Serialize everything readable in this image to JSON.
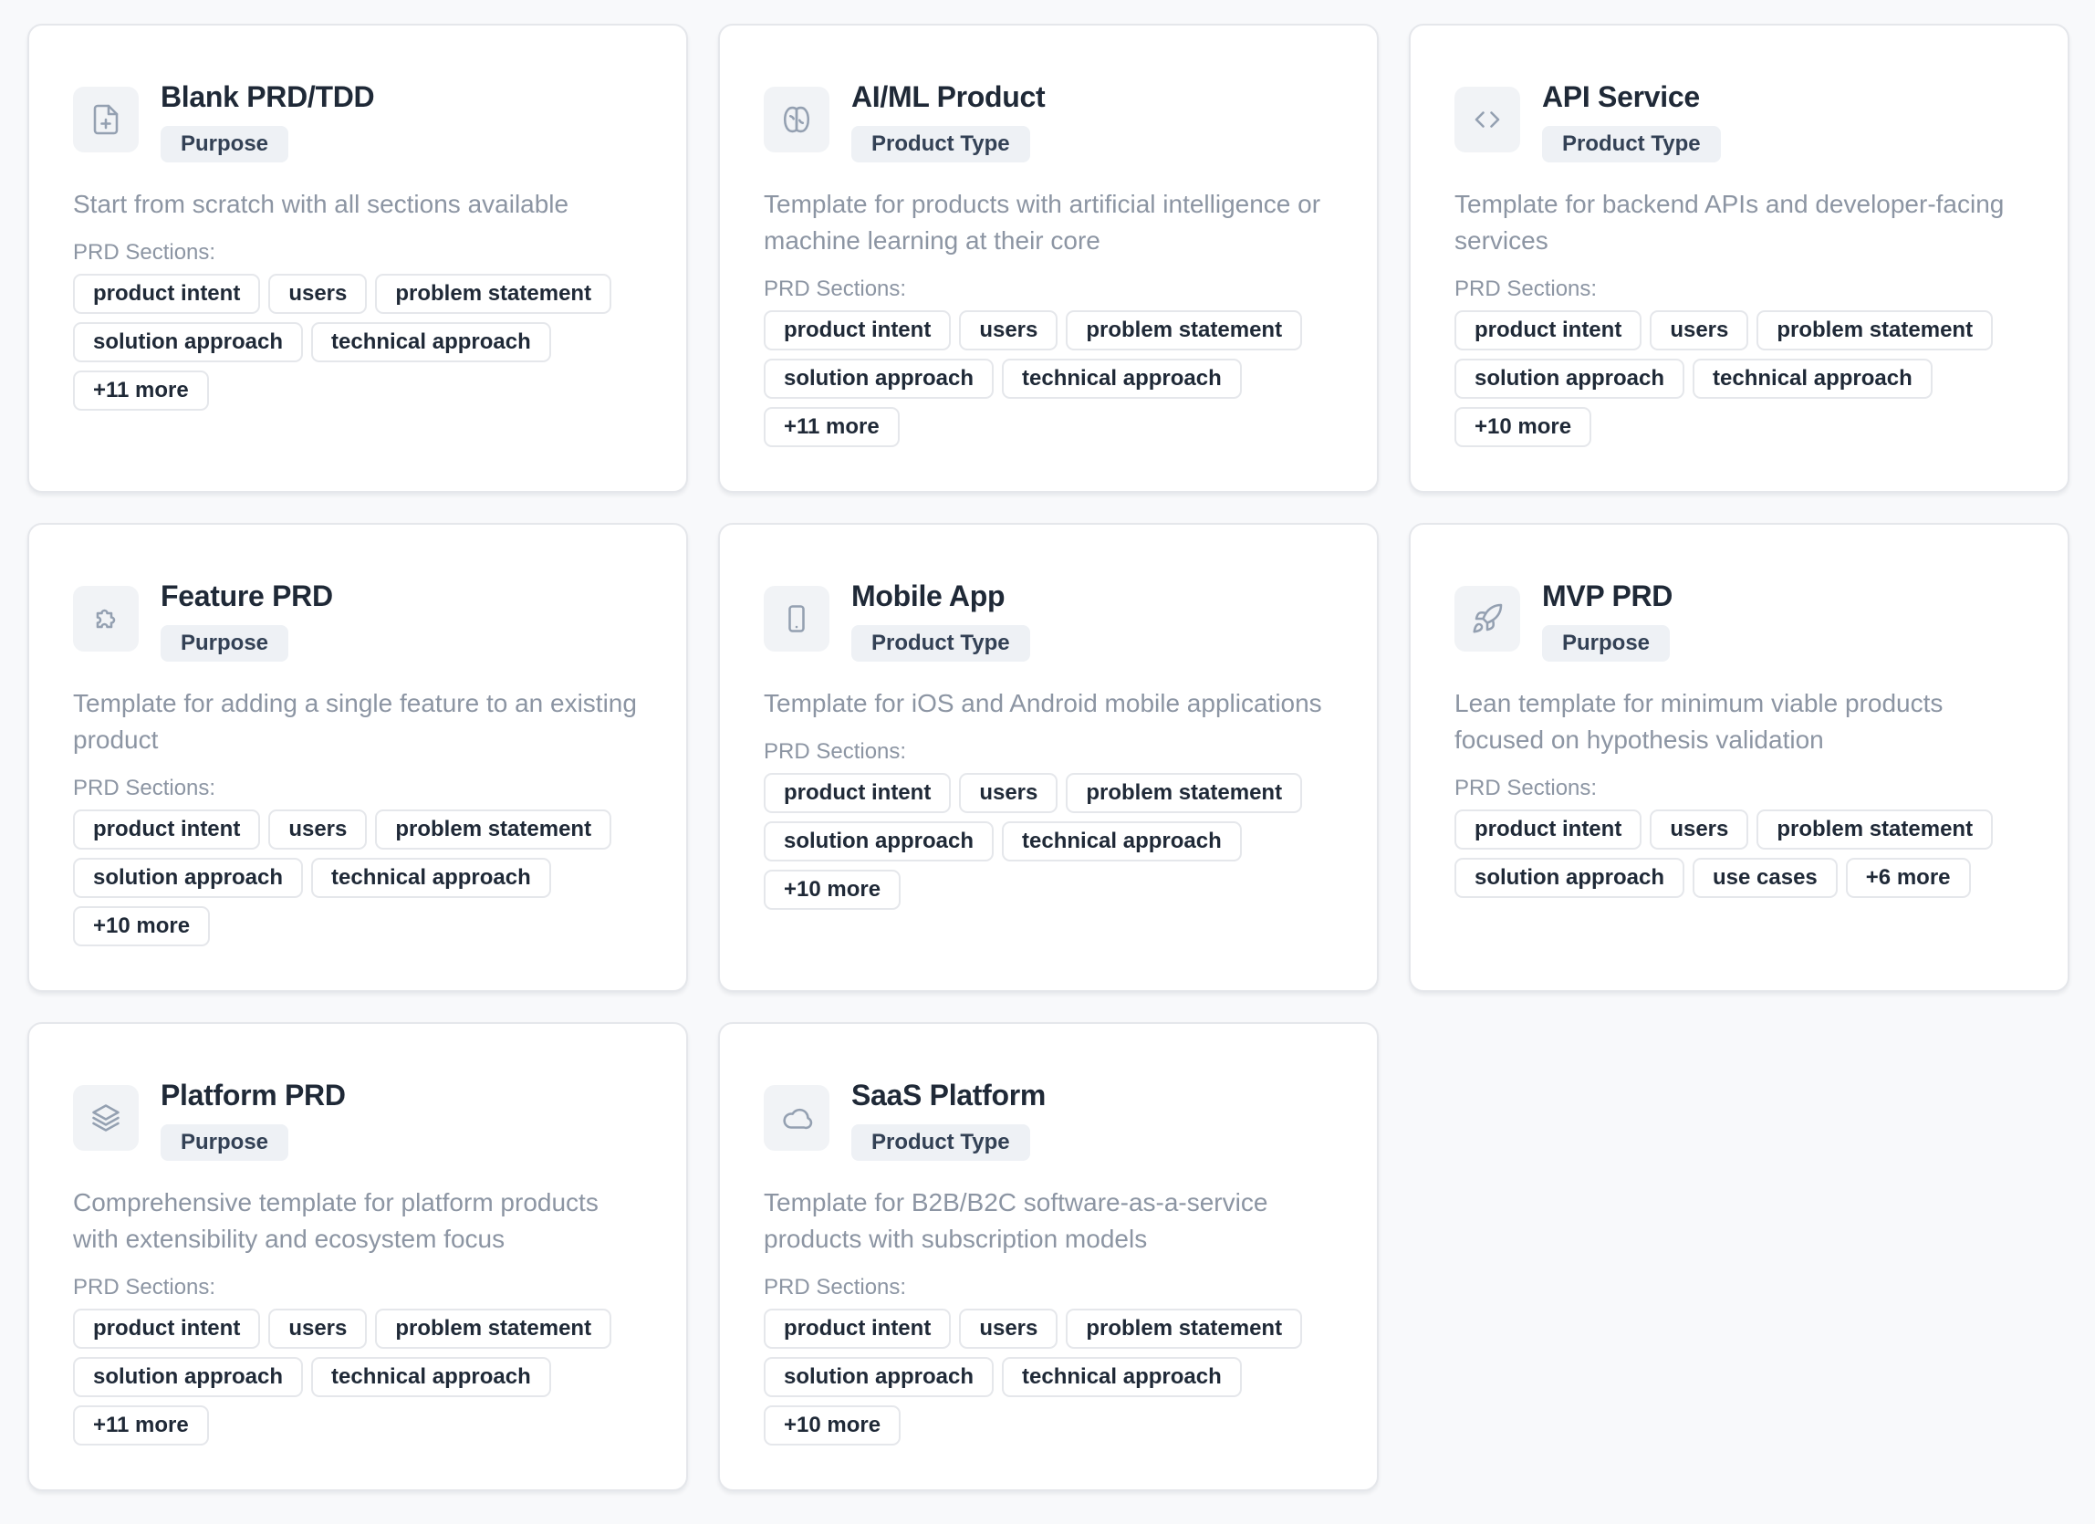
{
  "sections_label": "PRD Sections:",
  "templates": [
    {
      "title": "Blank PRD/TDD",
      "category": "Purpose",
      "icon": "file-plus-icon",
      "description": "Start from scratch with all sections available",
      "tags": [
        "product intent",
        "users",
        "problem statement",
        "solution approach",
        "technical approach"
      ],
      "more": "+11 more"
    },
    {
      "title": "AI/ML Product",
      "category": "Product Type",
      "icon": "brain-icon",
      "description": "Template for products with artificial intelligence or machine learning at their core",
      "tags": [
        "product intent",
        "users",
        "problem statement",
        "solution approach",
        "technical approach"
      ],
      "more": "+11 more"
    },
    {
      "title": "API Service",
      "category": "Product Type",
      "icon": "code-icon",
      "description": "Template for backend APIs and developer-facing services",
      "tags": [
        "product intent",
        "users",
        "problem statement",
        "solution approach",
        "technical approach"
      ],
      "more": "+10 more"
    },
    {
      "title": "Feature PRD",
      "category": "Purpose",
      "icon": "puzzle-icon",
      "description": "Template for adding a single feature to an existing product",
      "tags": [
        "product intent",
        "users",
        "problem statement",
        "solution approach",
        "technical approach"
      ],
      "more": "+10 more"
    },
    {
      "title": "Mobile App",
      "category": "Product Type",
      "icon": "smartphone-icon",
      "description": "Template for iOS and Android mobile applications",
      "tags": [
        "product intent",
        "users",
        "problem statement",
        "solution approach",
        "technical approach"
      ],
      "more": "+10 more"
    },
    {
      "title": "MVP PRD",
      "category": "Purpose",
      "icon": "rocket-icon",
      "description": "Lean template for minimum viable products focused on hypothesis validation",
      "tags": [
        "product intent",
        "users",
        "problem statement",
        "solution approach",
        "use cases"
      ],
      "more": "+6 more"
    },
    {
      "title": "Platform PRD",
      "category": "Purpose",
      "icon": "layers-icon",
      "description": "Comprehensive template for platform products with extensibility and ecosystem focus",
      "tags": [
        "product intent",
        "users",
        "problem statement",
        "solution approach",
        "technical approach"
      ],
      "more": "+11 more"
    },
    {
      "title": "SaaS Platform",
      "category": "Product Type",
      "icon": "cloud-icon",
      "description": "Template for B2B/B2C software-as-a-service products with subscription models",
      "tags": [
        "product intent",
        "users",
        "problem statement",
        "solution approach",
        "technical approach"
      ],
      "more": "+10 more"
    }
  ]
}
